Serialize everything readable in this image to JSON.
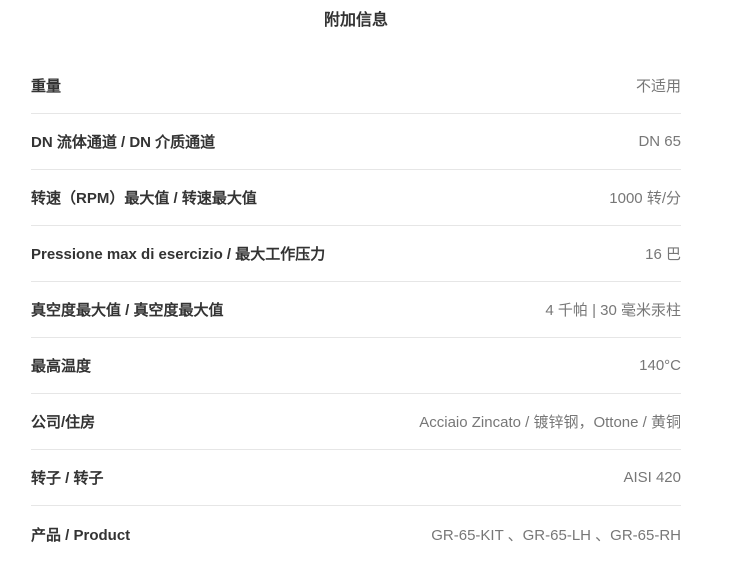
{
  "tab": {
    "title": "附加信息"
  },
  "rows": [
    {
      "label": "重量",
      "value": "不适用"
    },
    {
      "label": "DN 流体通道 / DN 介质通道",
      "value": "DN 65"
    },
    {
      "label": "转速（RPM）最大值 / 转速最大值",
      "value": "1000 转/分"
    },
    {
      "label": "Pressione max di esercizio / 最大工作压力",
      "value": "16 巴"
    },
    {
      "label": "真空度最大值 / 真空度最大值",
      "value": "4 千帕 | 30 毫米汞柱"
    },
    {
      "label": "最高温度",
      "value": "140°C"
    },
    {
      "label": "公司/住房",
      "value": "Acciaio Zincato / 镀锌钢，Ottone / 黄铜"
    },
    {
      "label": "转子 / 转子",
      "value": "AISI 420"
    },
    {
      "label": "产品 / Product",
      "value": "GR-65-KIT 、GR-65-LH 、GR-65-RH"
    }
  ]
}
